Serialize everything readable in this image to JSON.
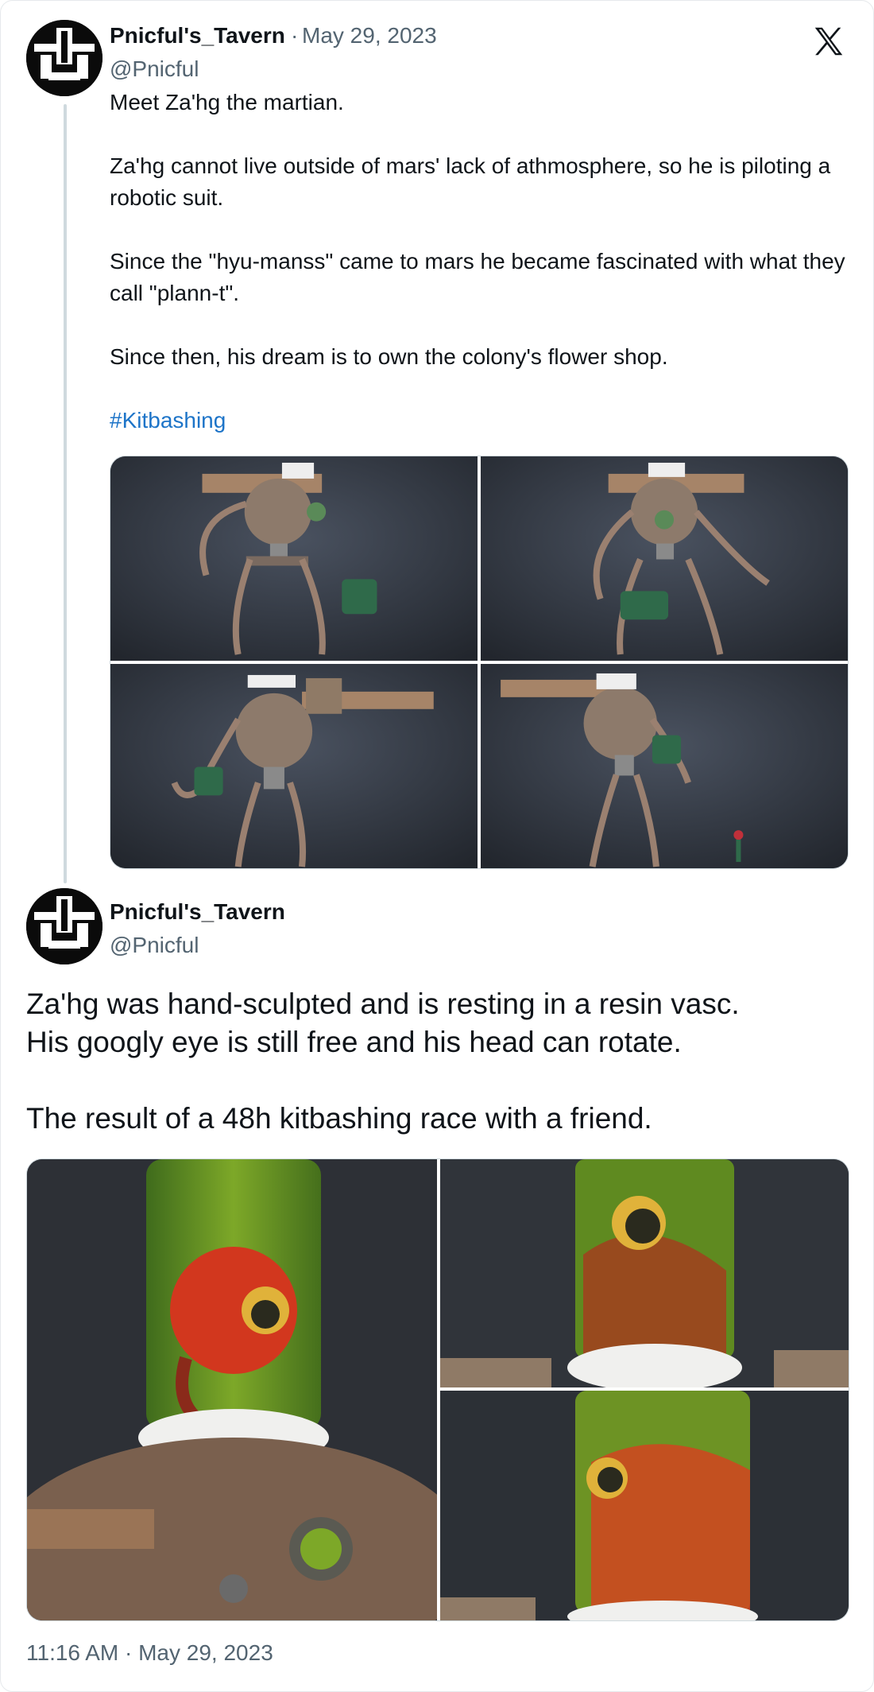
{
  "tweet1": {
    "display_name": "Pnicful's_Tavern",
    "separator": "·",
    "date": "May 29, 2023",
    "handle": "@Pnicful",
    "paragraphs": [
      "Meet Za'hg the martian.",
      "Za'hg cannot live outside of mars' lack of athmosphere, so he is piloting a robotic suit.",
      "Since the \"hyu-manss\" came to mars he became fascinated with what they call \"plann-t\".",
      "Since then, his dream is to own the colony's flower shop."
    ],
    "hashtag": "#Kitbashing",
    "media_count": 4
  },
  "tweet2": {
    "display_name": "Pnicful's_Tavern",
    "handle": "@Pnicful",
    "lines": [
      "Za'hg was hand-sculpted and is resting in a resin vasc.",
      "His googly eye is still free and his head can rotate.",
      "The result of a 48h kitbashing race with a friend."
    ],
    "media_count": 3
  },
  "footer": {
    "timestamp": "11:16 AM · May 29, 2023"
  },
  "icons": {
    "platform_logo": "x-logo-icon",
    "avatar": "tavern-logo-avatar"
  },
  "colors": {
    "text": "#0f1419",
    "secondary": "#536471",
    "link": "#1d74c8",
    "thread_line": "#cfd9de"
  }
}
